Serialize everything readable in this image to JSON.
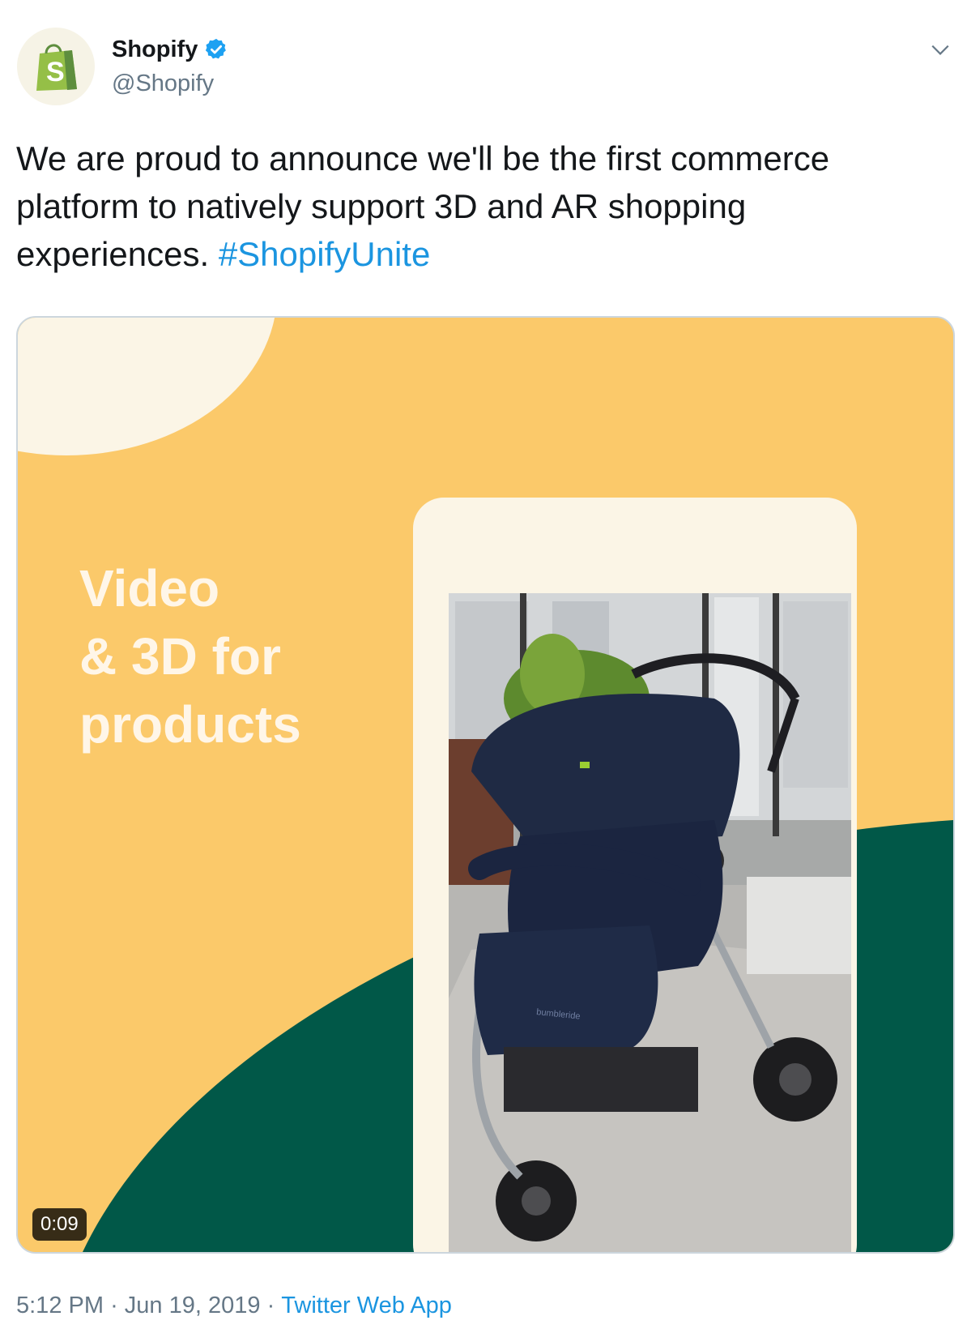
{
  "author": {
    "display_name": "Shopify",
    "handle": "@Shopify",
    "verified": true,
    "avatar_icon": "shopify-bag-icon"
  },
  "tweet": {
    "text": "We are proud to announce we'll be the first commerce platform to natively support 3D and AR shopping experiences.",
    "hashtag": "#ShopifyUnite"
  },
  "media": {
    "overlay_lines": [
      "Video",
      "& 3D for",
      "products"
    ],
    "duration": "0:09",
    "stroller_brand": "bumbleride"
  },
  "meta": {
    "time": "5:12 PM",
    "separator": "·",
    "date": "Jun 19, 2019",
    "source": "Twitter Web App"
  },
  "colors": {
    "media_yellow": "#fbc96a",
    "media_green": "#015848",
    "link_blue": "#1b95e0",
    "verified_blue": "#1da1f2",
    "muted_gray": "#657786"
  }
}
